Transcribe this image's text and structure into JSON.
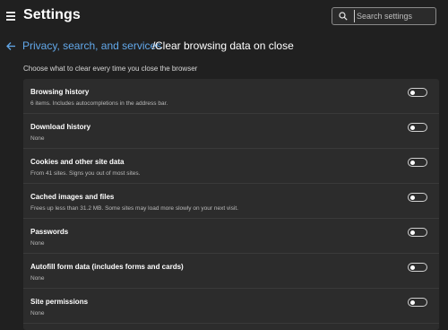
{
  "header": {
    "title": "Settings",
    "menu_icon": "hamburger-menu-icon",
    "search": {
      "placeholder": "Search settings",
      "value": "",
      "icon": "search-icon"
    }
  },
  "breadcrumb": {
    "back_icon": "back-arrow-icon",
    "parent": "Privacy, search, and services",
    "separator": "/",
    "current": "Clear browsing data on close"
  },
  "subtitle": "Choose what to clear every time you close the browser",
  "colors": {
    "background": "#202020",
    "panel": "#2c2c2c",
    "link": "#62a8ea",
    "divider": "#3a3a3a"
  },
  "items": [
    {
      "label": "Browsing history",
      "description": "6 items. Includes autocompletions in the address bar.",
      "enabled": false
    },
    {
      "label": "Download history",
      "description": "None",
      "enabled": false
    },
    {
      "label": "Cookies and other site data",
      "description": "From 41 sites. Signs you out of most sites.",
      "enabled": false
    },
    {
      "label": "Cached images and files",
      "description": "Frees up less than 31.2 MB. Some sites may load more slowly on your next visit.",
      "enabled": false
    },
    {
      "label": "Passwords",
      "description": "None",
      "enabled": false
    },
    {
      "label": "Autofill form data (includes forms and cards)",
      "description": "None",
      "enabled": false
    },
    {
      "label": "Site permissions",
      "description": "None",
      "enabled": false
    }
  ]
}
